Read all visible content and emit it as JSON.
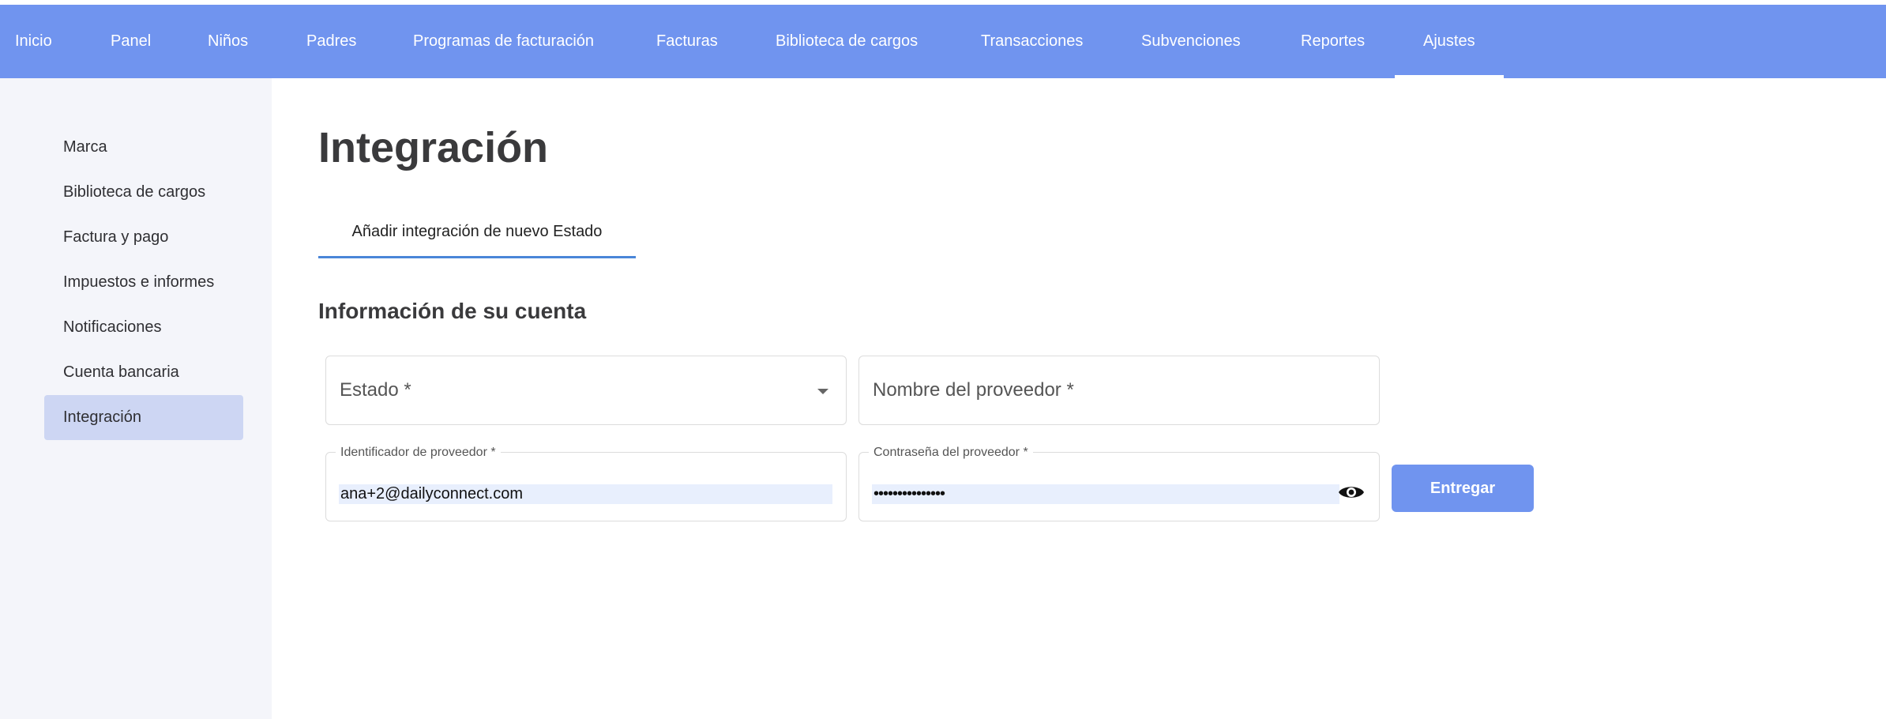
{
  "nav": {
    "items": [
      "Inicio",
      "Panel",
      "Niños",
      "Padres",
      "Programas de facturación",
      "Facturas",
      "Biblioteca de cargos",
      "Transacciones",
      "Subvenciones",
      "Reportes",
      "Ajustes"
    ],
    "active": "Ajustes"
  },
  "sidebar": {
    "items": [
      "Marca",
      "Biblioteca de cargos",
      "Factura y pago",
      "Impuestos e informes",
      "Notificaciones",
      "Cuenta bancaria",
      "Integración"
    ],
    "active": "Integración"
  },
  "main": {
    "title": "Integración",
    "tab_label": "Añadir integración de nuevo Estado",
    "section_title": "Información de su cuenta"
  },
  "form": {
    "state": {
      "placeholder": "Estado *",
      "icon": "chevron-down-icon"
    },
    "provider_name": {
      "placeholder": "Nombre del proveedor *"
    },
    "provider_id": {
      "label": "Identificador de proveedor *",
      "value": "ana+2@dailyconnect.com"
    },
    "provider_password": {
      "label": "Contraseña del proveedor *",
      "value": "•••••••••••••••",
      "icon": "eye-icon"
    },
    "submit_label": "Entregar"
  },
  "colors": {
    "accent": "#7094ef",
    "sidebar_bg": "#f4f5fa",
    "sidebar_active": "#cdd6f3",
    "tab_underline": "#4a86d8",
    "autofill_bg": "#e8effd"
  }
}
